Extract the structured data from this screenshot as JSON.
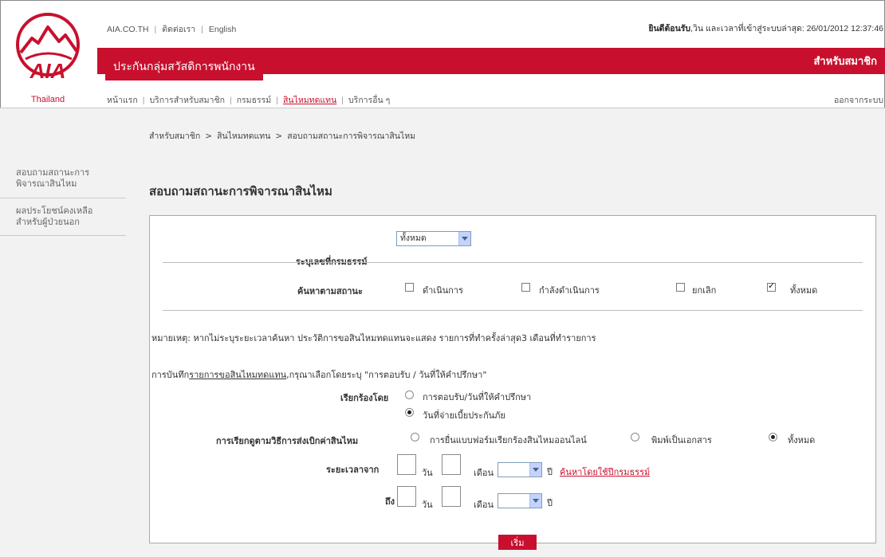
{
  "header": {
    "logo_text": "AIA",
    "logo_country": "Thailand",
    "top_links": [
      "AIA.CO.TH",
      "ติดต่อเรา",
      "English"
    ],
    "welcome_prefix": "ยินดีต้อนรับ",
    "welcome_rest": ",วิน และเวลาที่เข้าสู่ระบบล่าสุด: 26/01/2012 12:37:46",
    "site_title": "ประกันกลุ่มสวัสดิการพนักงาน",
    "member_label": "สำหรับสมาชิก",
    "nav": [
      "หน้าแรก",
      "บริการสำหรับสมาชิก",
      "กรมธรรม์",
      "สินไหมทดแทน",
      "บริการอื่น ๆ"
    ],
    "logout": "ออกจากระบบ"
  },
  "sidebar": {
    "items": [
      {
        "label_line1": "สอบถามสถานะการ",
        "label_line2": "พิจารณาสินไหม"
      },
      {
        "label_line1": "ผลประโยชน์คงเหลือ",
        "label_line2": "สำหรับผู้ป่วยนอก"
      }
    ]
  },
  "breadcrumb": [
    "สำหรับสมาชิก",
    "สินไหมทดแทน",
    "สอบถามสถานะการพิจารณาสินไหม"
  ],
  "breadcrumb_sep": ">",
  "page_title": "สอบถามสถานะการพิจารณาสินไหม",
  "form": {
    "policy_label": "ระบุเลขที่กรมธรรม์",
    "policy_select_value": "ทั้งหมด",
    "status_label": "ค้นหาตามสถานะ",
    "status_options": [
      {
        "label": "ดำเนินการ",
        "checked": false
      },
      {
        "label": "กำลังดำเนินการ",
        "checked": false
      },
      {
        "label": "ยกเลิก",
        "checked": false
      },
      {
        "label": "ทั้งหมด",
        "checked": true
      }
    ],
    "note": "หมายเหตุ: หากไม่ระบุระยะเวลาค้นหา ประวัติการขอสินไหมทดแทนจะแสดง รายการที่ทำครั้งล่าสุด3 เดือนที่ทำรายการ",
    "record_prefix": "การบันทึก",
    "record_link": "รายการขอสินไหมทดแทน",
    "record_suffix": ",กรุณาเลือกโดยระบุ \"การตอบรับ / วันที่ให้คำปรึกษา\"",
    "claim_by_label": "เรียกร้องโดย",
    "claim_by_options": [
      {
        "label": "การตอบรับ/วันที่ให้คำปรึกษา",
        "selected": false
      },
      {
        "label": "วันที่จ่ายเบี้ยประกันภัย",
        "selected": true
      }
    ],
    "submit_method_label": "การเรียกดูตามวิธีการส่งเบิกค่าสินไหม",
    "submit_method_options": [
      {
        "label": "การยื่นแบบฟอร์มเรียกร้องสินไหมออนไลน์",
        "selected": false
      },
      {
        "label": "พิมพ์เป็นเอกสาร",
        "selected": false
      },
      {
        "label": "ทั้งหมด",
        "selected": true
      }
    ],
    "period_from_label": "ระยะเวลาจาก",
    "period_to_label": "ถึง",
    "day_label": "วัน",
    "month_label": "เดือน",
    "year_label": "ปี",
    "search_by_policy_year_link": "ค้นหาโดยใช้ปีกรมธรรม์",
    "start_button": "เริ่ม"
  }
}
